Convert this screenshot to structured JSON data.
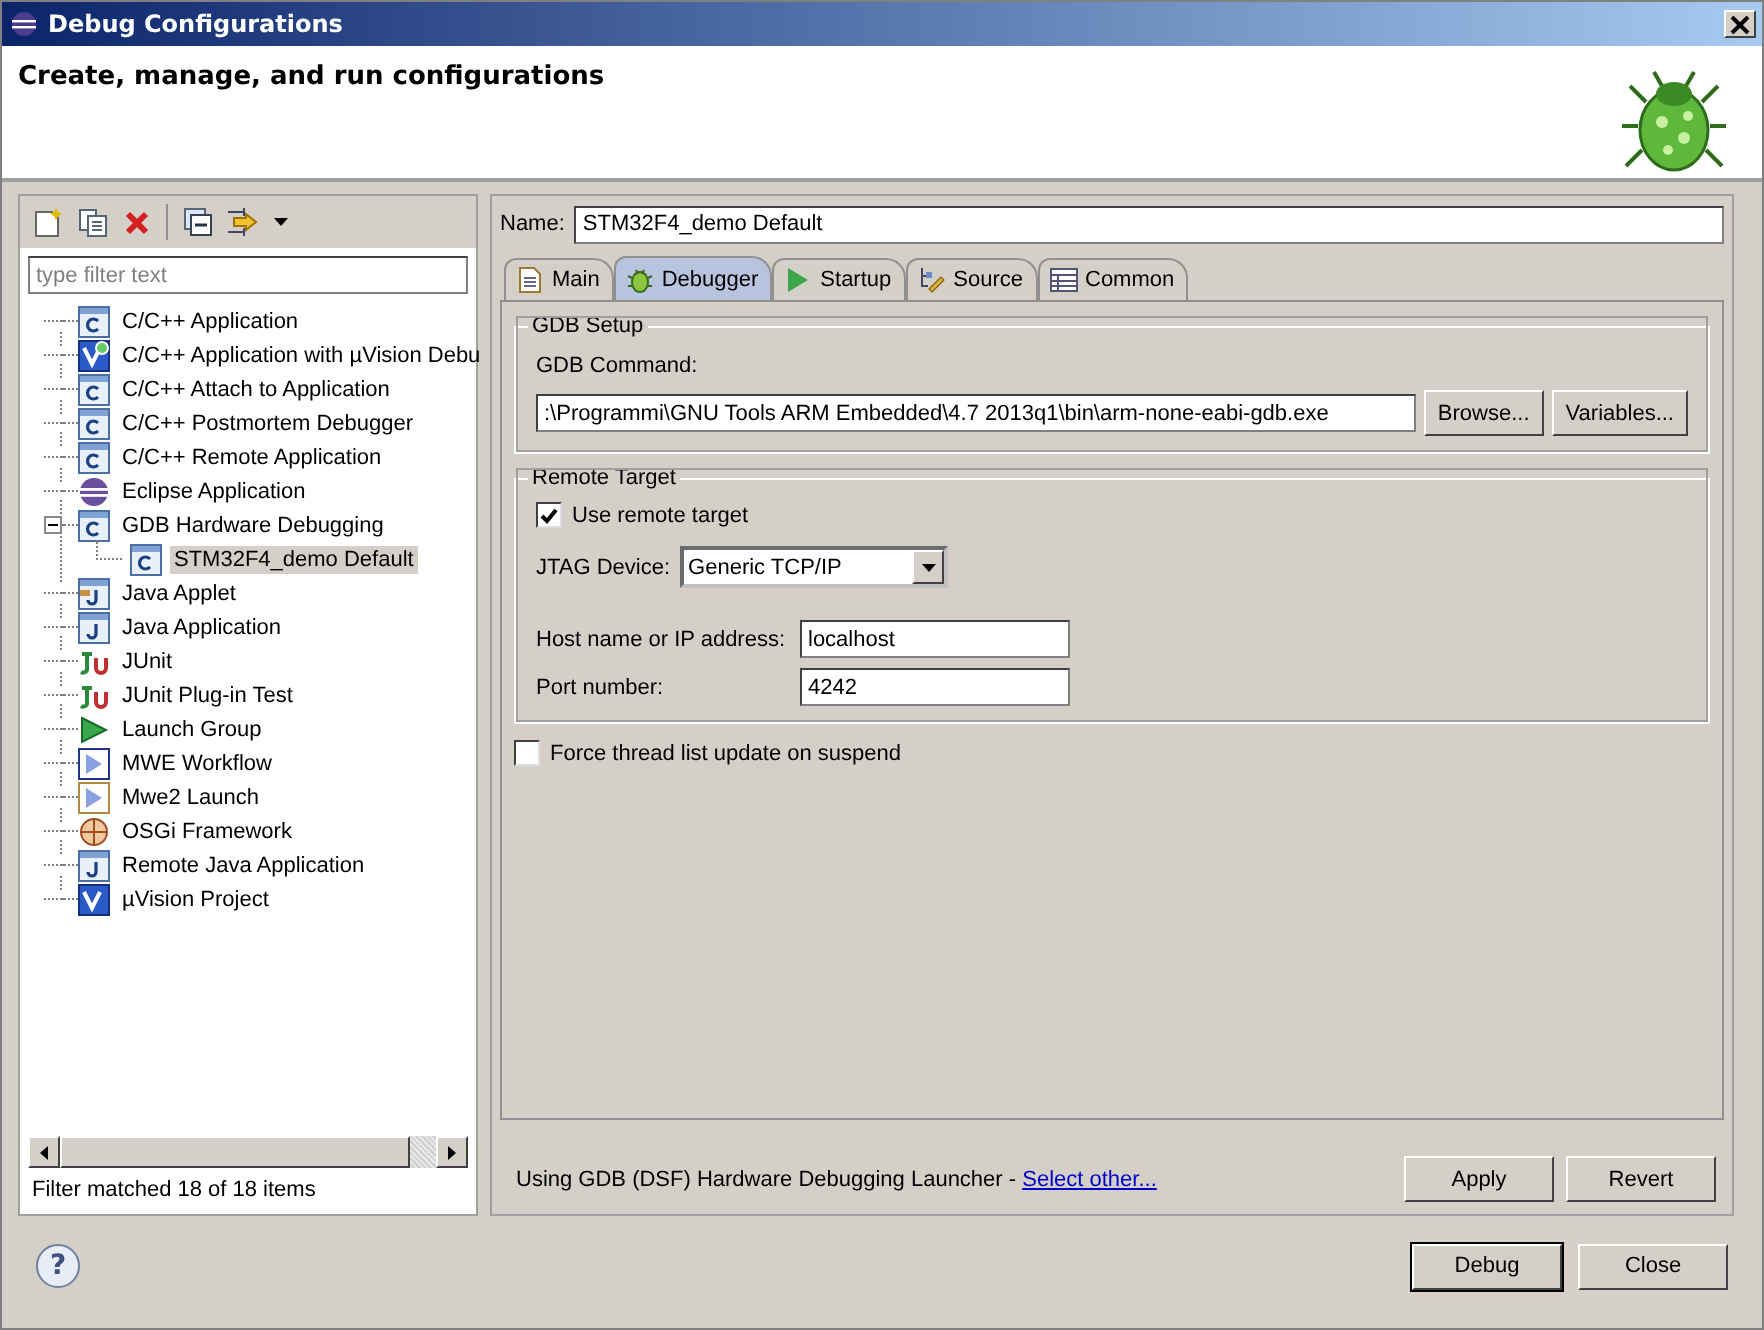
{
  "window": {
    "title": "Debug Configurations"
  },
  "header": {
    "title": "Create, manage, and run configurations"
  },
  "filter": {
    "placeholder": "type filter text"
  },
  "tree": [
    {
      "label": "C/C++ Application",
      "kind": "c",
      "selected": false
    },
    {
      "label": "C/C++ Application with µVision Debu",
      "kind": "uvision-c",
      "selected": false
    },
    {
      "label": "C/C++ Attach to Application",
      "kind": "c",
      "selected": false
    },
    {
      "label": "C/C++ Postmortem Debugger",
      "kind": "c",
      "selected": false
    },
    {
      "label": "C/C++ Remote Application",
      "kind": "c",
      "selected": false
    },
    {
      "label": "Eclipse Application",
      "kind": "eclipse",
      "selected": false
    },
    {
      "label": "GDB Hardware Debugging",
      "kind": "c",
      "selected": false,
      "expanded": true,
      "children": [
        {
          "label": "STM32F4_demo Default",
          "kind": "c",
          "selected": true
        }
      ]
    },
    {
      "label": "Java Applet",
      "kind": "applet",
      "selected": false
    },
    {
      "label": "Java Application",
      "kind": "java",
      "selected": false
    },
    {
      "label": "JUnit",
      "kind": "junit",
      "selected": false
    },
    {
      "label": "JUnit Plug-in Test",
      "kind": "junit",
      "selected": false
    },
    {
      "label": "Launch Group",
      "kind": "launch",
      "selected": false
    },
    {
      "label": "MWE Workflow",
      "kind": "mwe",
      "selected": false
    },
    {
      "label": "Mwe2 Launch",
      "kind": "mwe2",
      "selected": false
    },
    {
      "label": "OSGi Framework",
      "kind": "osgi",
      "selected": false
    },
    {
      "label": "Remote Java Application",
      "kind": "remote-java",
      "selected": false
    },
    {
      "label": "µVision Project",
      "kind": "uvision",
      "selected": false
    }
  ],
  "filter_status": "Filter matched 18 of 18 items",
  "name": {
    "label": "Name:",
    "value": "STM32F4_demo Default"
  },
  "tabs": [
    {
      "label": "Main",
      "kind": "main",
      "selected": false
    },
    {
      "label": "Debugger",
      "kind": "debugger",
      "selected": true
    },
    {
      "label": "Startup",
      "kind": "startup",
      "selected": false
    },
    {
      "label": "Source",
      "kind": "source",
      "selected": false
    },
    {
      "label": "Common",
      "kind": "common",
      "selected": false
    }
  ],
  "gdb_setup": {
    "title": "GDB Setup",
    "command_label": "GDB Command:",
    "command_value": ":\\Programmi\\GNU Tools ARM Embedded\\4.7 2013q1\\bin\\arm-none-eabi-gdb.exe",
    "buttons": [
      "Browse...",
      "Variables..."
    ]
  },
  "remote_target": {
    "title": "Remote Target",
    "use_remote": {
      "label": "Use remote target",
      "checked": true
    },
    "jtag": {
      "label": "JTAG Device:",
      "value": "Generic TCP/IP"
    },
    "host": {
      "label": "Host name or IP address:",
      "value": "localhost"
    },
    "port": {
      "label": "Port number:",
      "value": "4242"
    }
  },
  "force_thread": {
    "label": "Force thread list update on suspend",
    "checked": false
  },
  "launcher": {
    "text": "Using GDB (DSF) Hardware Debugging Launcher - ",
    "link": "Select other..."
  },
  "actions": [
    "Apply",
    "Revert"
  ],
  "help": "?",
  "footer_buttons": [
    {
      "label": "Debug",
      "default": true
    },
    {
      "label": "Close",
      "default": false
    }
  ]
}
